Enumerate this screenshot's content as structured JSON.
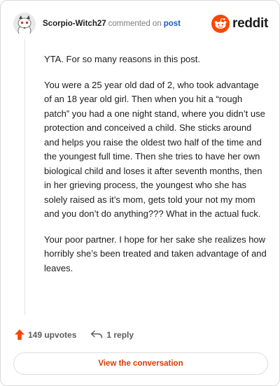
{
  "header": {
    "username": "Scorpio-Witch27",
    "action_text": "commented on",
    "post_link": "post",
    "brand_name": "reddit"
  },
  "comment": {
    "paragraphs": [
      "YTA. For so many reasons in this post.",
      "You were a 25 year old dad of 2, who took advantage of an 18 year old girl. Then when you hit a “rough patch” you had a one night stand, where you didn’t use protection and conceived a child. She sticks around and helps you raise the oldest two half of the time and the youngest full time. Then she tries to have her own biological child and loses it after seventh months, then in her grieving process, the youngest who she has solely raised as it’s mom, gets told your not my mom and you don’t do anything??? What in the actual fuck.",
      "Your poor partner. I hope for her sake she realizes how horribly she’s been treated and taken advantage of and leaves."
    ]
  },
  "actions": {
    "upvotes": "149 upvotes",
    "replies": "1 reply"
  },
  "footer": {
    "view_button": "View the conversation"
  },
  "colors": {
    "reddit_orange": "#ff4500",
    "button_text": "#d93a00",
    "link_blue": "#1a5dbf"
  }
}
